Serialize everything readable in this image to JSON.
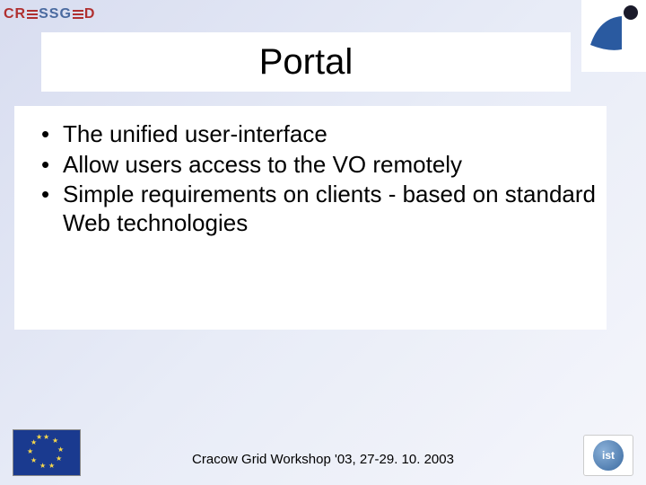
{
  "logos": {
    "topleft_name": "crossgrid",
    "topright_name": "partner-logo",
    "eu_flag_name": "eu-flag",
    "ist_name": "ist"
  },
  "title": "Portal",
  "bullets": [
    "The unified user-interface",
    "Allow users access to the VO remotely",
    "Simple requirements on clients - based on standard Web technologies"
  ],
  "footer": "Cracow Grid Workshop '03, 27-29. 10. 2003"
}
